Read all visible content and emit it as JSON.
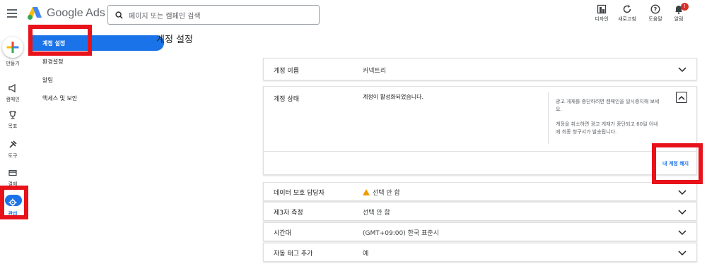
{
  "header": {
    "app_name": "Google Ads",
    "search_placeholder": "페이지 또는 캠페인 검색",
    "tools": [
      {
        "icon": "design-icon",
        "label": "디자인"
      },
      {
        "icon": "refresh-icon",
        "label": "새로고침"
      },
      {
        "icon": "help-icon",
        "label": "도움말"
      },
      {
        "icon": "bell-icon",
        "label": "알림",
        "badge": "!"
      }
    ]
  },
  "rail": {
    "create_label": "만들기",
    "items": [
      {
        "icon": "megaphone-icon",
        "label": "캠페인"
      },
      {
        "icon": "trophy-icon",
        "label": "목표"
      },
      {
        "icon": "tools-icon",
        "label": "도구"
      },
      {
        "icon": "credit-card-icon",
        "label": "결제"
      },
      {
        "icon": "gear-icon",
        "label": "관리",
        "active": true
      }
    ]
  },
  "subnav": {
    "active": "계정 설정",
    "items": [
      "환경설정",
      "알림",
      "액세스 및 보안"
    ]
  },
  "main": {
    "title": "계정 설정",
    "account_name": {
      "label": "계정 이름",
      "value": "커넥트리"
    },
    "account_status": {
      "label": "계정 상태",
      "value": "계정이 활성화되었습니다.",
      "help_1": "광고 게재를 중단하려면 캠페인을 일시중지해 보세요.",
      "help_2": "계정을 취소하면 광고 게재가 중단되고 60일 이내에 최종 청구서가 발송됩니다.",
      "action": "내 계정 해지"
    },
    "rows": [
      {
        "label": "데이터 보호 담당자",
        "value": "선택 안 함",
        "warning": true
      },
      {
        "label": "제3자 측정",
        "value": "선택 안 함"
      },
      {
        "label": "시간대",
        "value": "(GMT+09:00) 한국 표준시"
      },
      {
        "label": "자동 태그 추가",
        "value": "예"
      }
    ]
  },
  "colors": {
    "accent": "#1a73e8",
    "highlight": "#e8121b",
    "warning": "#f29900"
  }
}
